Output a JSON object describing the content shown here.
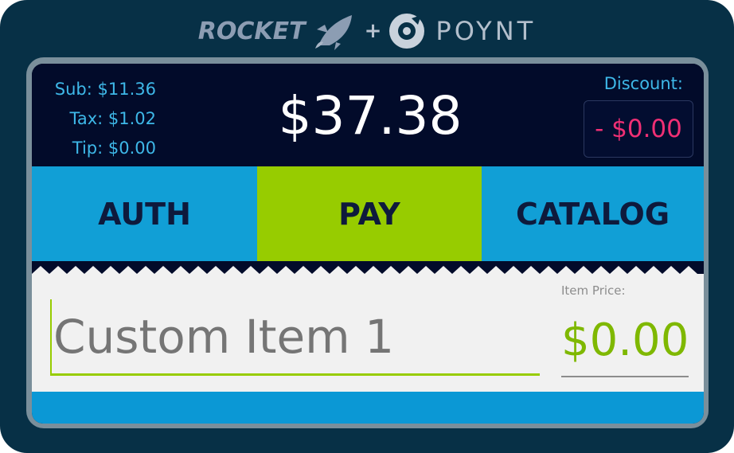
{
  "branding": {
    "rocket_text": "ROCKET",
    "plus": "+",
    "poynt_text": "POYNT",
    "icons": [
      "rocket-icon",
      "poynt-logo-icon"
    ]
  },
  "totals": {
    "sub": "Sub: $11.36",
    "tax": "Tax: $1.02",
    "tip": "Tip: $0.00",
    "grand_total": "$37.38",
    "discount_label": "Discount:",
    "discount_value": "- $0.00"
  },
  "actions": {
    "auth": "AUTH",
    "pay": "PAY",
    "catalog": "CATALOG"
  },
  "item": {
    "name_placeholder": "Custom Item 1",
    "price_label": "Item Price:",
    "price_value": "$0.00"
  },
  "colors": {
    "frame": "#073046",
    "screen": "#020b2a",
    "accent_blue": "#119fd6",
    "accent_green": "#97cc00",
    "discount_pink": "#f02f74",
    "label_blue": "#3eb8e8"
  }
}
